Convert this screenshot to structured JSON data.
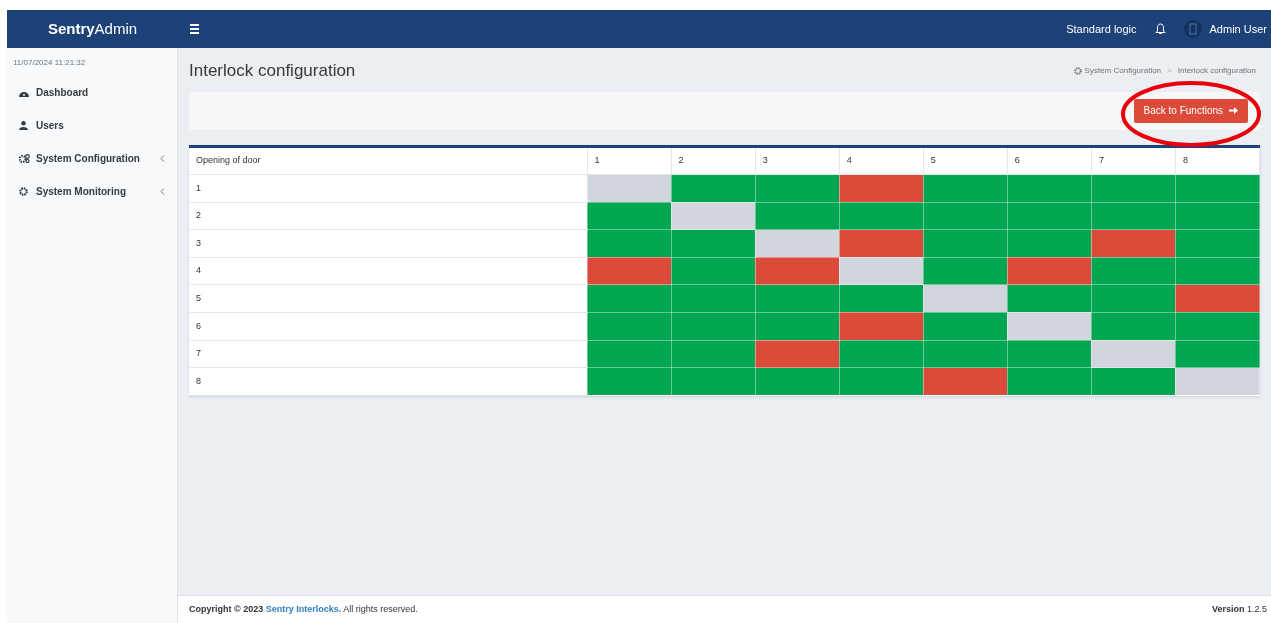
{
  "brand": {
    "bold": "Sentry",
    "light": "Admin"
  },
  "header": {
    "logic_label": "Standard logic",
    "user_name": "Admin User"
  },
  "sidebar": {
    "datetime": "11/07/2024 11:21:32",
    "items": [
      {
        "label": "Dashboard",
        "has_submenu": false
      },
      {
        "label": "Users",
        "has_submenu": false
      },
      {
        "label": "System Configuration",
        "has_submenu": true
      },
      {
        "label": "System Monitoring",
        "has_submenu": true
      }
    ]
  },
  "page_title": "Interlock configuration",
  "breadcrumb": {
    "separator": ">",
    "items": [
      {
        "label": "System Configuration"
      },
      {
        "label": "Interlock configuration"
      }
    ]
  },
  "action_button": {
    "label": "Back to Functions"
  },
  "annotation": {
    "kind": "ellipse",
    "color": "#e8000b"
  },
  "table": {
    "corner": "Opening of door",
    "columns": [
      "1",
      "2",
      "3",
      "4",
      "5",
      "6",
      "7",
      "8"
    ],
    "rows": [
      {
        "label": "1",
        "cells": [
          {
            "kind": "self"
          },
          {
            "kind": "allowed"
          },
          {
            "kind": "allowed"
          },
          {
            "kind": "blocked"
          },
          {
            "kind": "allowed"
          },
          {
            "kind": "allowed"
          },
          {
            "kind": "allowed"
          },
          {
            "kind": "allowed"
          }
        ]
      },
      {
        "label": "2",
        "cells": [
          {
            "kind": "allowed"
          },
          {
            "kind": "self"
          },
          {
            "kind": "allowed"
          },
          {
            "kind": "allowed"
          },
          {
            "kind": "allowed"
          },
          {
            "kind": "allowed"
          },
          {
            "kind": "allowed"
          },
          {
            "kind": "allowed"
          }
        ]
      },
      {
        "label": "3",
        "cells": [
          {
            "kind": "allowed"
          },
          {
            "kind": "allowed"
          },
          {
            "kind": "self"
          },
          {
            "kind": "blocked"
          },
          {
            "kind": "allowed"
          },
          {
            "kind": "allowed"
          },
          {
            "kind": "blocked"
          },
          {
            "kind": "allowed"
          }
        ]
      },
      {
        "label": "4",
        "cells": [
          {
            "kind": "blocked"
          },
          {
            "kind": "allowed"
          },
          {
            "kind": "blocked"
          },
          {
            "kind": "self"
          },
          {
            "kind": "allowed"
          },
          {
            "kind": "blocked"
          },
          {
            "kind": "allowed"
          },
          {
            "kind": "allowed"
          }
        ]
      },
      {
        "label": "5",
        "cells": [
          {
            "kind": "allowed"
          },
          {
            "kind": "allowed"
          },
          {
            "kind": "allowed"
          },
          {
            "kind": "allowed"
          },
          {
            "kind": "self"
          },
          {
            "kind": "allowed"
          },
          {
            "kind": "allowed"
          },
          {
            "kind": "blocked"
          }
        ]
      },
      {
        "label": "6",
        "cells": [
          {
            "kind": "allowed"
          },
          {
            "kind": "allowed"
          },
          {
            "kind": "allowed"
          },
          {
            "kind": "blocked"
          },
          {
            "kind": "allowed"
          },
          {
            "kind": "self"
          },
          {
            "kind": "allowed"
          },
          {
            "kind": "allowed"
          }
        ]
      },
      {
        "label": "7",
        "cells": [
          {
            "kind": "allowed"
          },
          {
            "kind": "allowed"
          },
          {
            "kind": "blocked"
          },
          {
            "kind": "allowed"
          },
          {
            "kind": "allowed"
          },
          {
            "kind": "allowed"
          },
          {
            "kind": "self"
          },
          {
            "kind": "allowed"
          }
        ]
      },
      {
        "label": "8",
        "cells": [
          {
            "kind": "allowed"
          },
          {
            "kind": "allowed"
          },
          {
            "kind": "allowed"
          },
          {
            "kind": "allowed"
          },
          {
            "kind": "blocked"
          },
          {
            "kind": "allowed"
          },
          {
            "kind": "allowed"
          },
          {
            "kind": "self"
          }
        ]
      }
    ]
  },
  "footer": {
    "copyright": "Copyright © 2023 ",
    "company": "Sentry Interlocks.",
    "rights": " All rights reserved.",
    "version_label": "Version",
    "version": "1.2.5"
  }
}
